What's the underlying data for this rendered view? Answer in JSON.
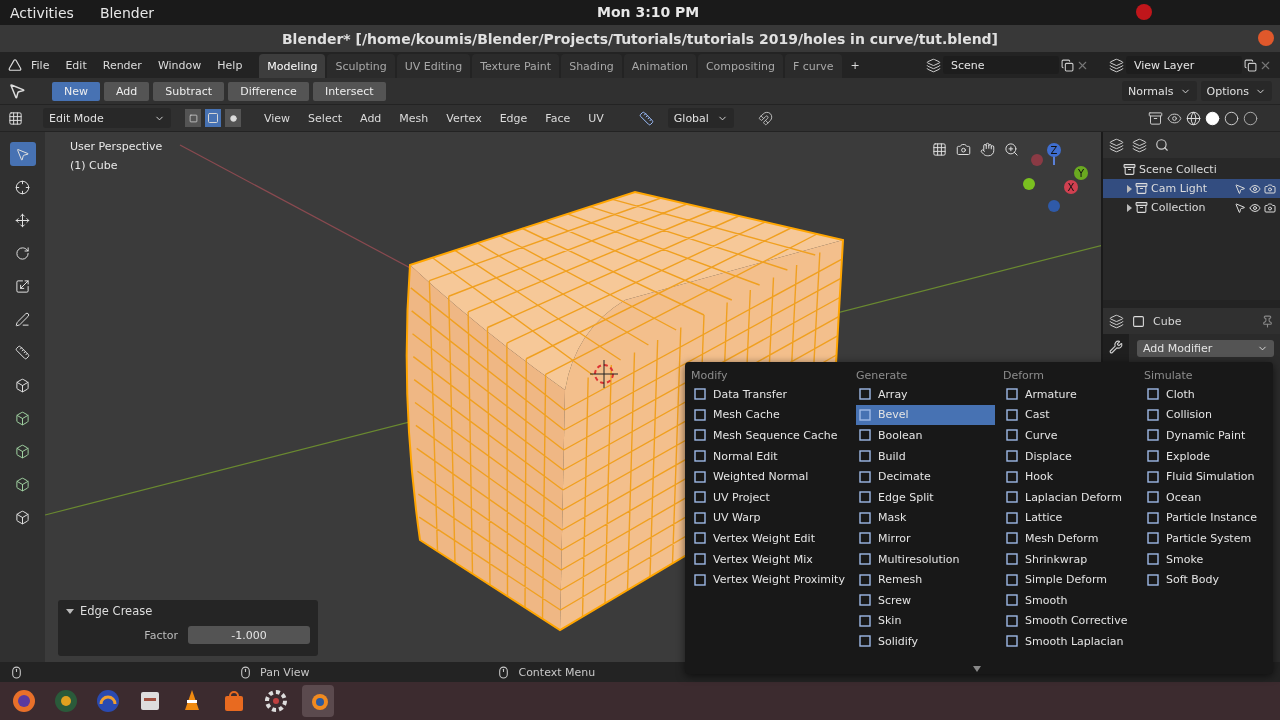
{
  "system_bar": {
    "activities": "Activities",
    "app": "Blender",
    "clock": "Mon  3:10 PM"
  },
  "window": {
    "title": "Blender* [/home/koumis/Blender/Projects/Tutorials/tutorials 2019/holes in curve/tut.blend]"
  },
  "menu_bar": [
    "File",
    "Edit",
    "Render",
    "Window",
    "Help"
  ],
  "workspaces": [
    {
      "label": "Modeling",
      "selected": true
    },
    {
      "label": "Sculpting",
      "selected": false
    },
    {
      "label": "UV Editing",
      "selected": false
    },
    {
      "label": "Texture Paint",
      "selected": false
    },
    {
      "label": "Shading",
      "selected": false
    },
    {
      "label": "Animation",
      "selected": false
    },
    {
      "label": "Compositing",
      "selected": false
    },
    {
      "label": "F curve",
      "selected": false
    }
  ],
  "add_workspace": "+",
  "scene": "Scene",
  "view_layer": "View Layer",
  "tool_header": {
    "modes": [
      {
        "label": "New",
        "selected": true
      },
      {
        "label": "Add",
        "selected": false
      },
      {
        "label": "Subtract",
        "selected": false
      },
      {
        "label": "Difference",
        "selected": false
      },
      {
        "label": "Intersect",
        "selected": false
      }
    ],
    "buttons": [
      "Normals",
      "Options"
    ]
  },
  "viewport_header": {
    "mode": "Edit Mode",
    "select_modes": [
      {
        "kind": "vertex",
        "selected": false
      },
      {
        "kind": "edge",
        "selected": true
      },
      {
        "kind": "face",
        "selected": false
      }
    ],
    "menus": [
      "View",
      "Select",
      "Add",
      "Mesh",
      "Vertex",
      "Edge",
      "Face",
      "UV"
    ],
    "orientation": "Global"
  },
  "viewport": {
    "perspective": "User Perspective",
    "object": "(1) Cube",
    "gizmo_axes": [
      "Z",
      "Y",
      "X"
    ]
  },
  "outliner": {
    "items": [
      {
        "label": "Scene Collecti",
        "children": [
          {
            "label": "Cam Light",
            "selected": true
          },
          {
            "label": "Collection",
            "selected": false
          }
        ]
      }
    ]
  },
  "properties": {
    "object": "Cube",
    "add_modifier": "Add Modifier"
  },
  "modifier_menu": {
    "columns": [
      {
        "heading": "Modify",
        "items": [
          {
            "label": "Data Transfer",
            "selected": false
          },
          {
            "label": "Mesh Cache",
            "selected": false
          },
          {
            "label": "Mesh Sequence Cache",
            "selected": false
          },
          {
            "label": "Normal Edit",
            "selected": false
          },
          {
            "label": "Weighted Normal",
            "selected": false
          },
          {
            "label": "UV Project",
            "selected": false
          },
          {
            "label": "UV Warp",
            "selected": false
          },
          {
            "label": "Vertex Weight Edit",
            "selected": false
          },
          {
            "label": "Vertex Weight Mix",
            "selected": false
          },
          {
            "label": "Vertex Weight Proximity",
            "selected": false
          }
        ]
      },
      {
        "heading": "Generate",
        "items": [
          {
            "label": "Array",
            "selected": false
          },
          {
            "label": "Bevel",
            "selected": true
          },
          {
            "label": "Boolean",
            "selected": false
          },
          {
            "label": "Build",
            "selected": false
          },
          {
            "label": "Decimate",
            "selected": false
          },
          {
            "label": "Edge Split",
            "selected": false
          },
          {
            "label": "Mask",
            "selected": false
          },
          {
            "label": "Mirror",
            "selected": false
          },
          {
            "label": "Multiresolution",
            "selected": false
          },
          {
            "label": "Remesh",
            "selected": false
          },
          {
            "label": "Screw",
            "selected": false
          },
          {
            "label": "Skin",
            "selected": false
          },
          {
            "label": "Solidify",
            "selected": false
          }
        ]
      },
      {
        "heading": "Deform",
        "items": [
          {
            "label": "Armature",
            "selected": false
          },
          {
            "label": "Cast",
            "selected": false
          },
          {
            "label": "Curve",
            "selected": false
          },
          {
            "label": "Displace",
            "selected": false
          },
          {
            "label": "Hook",
            "selected": false
          },
          {
            "label": "Laplacian Deform",
            "selected": false
          },
          {
            "label": "Lattice",
            "selected": false
          },
          {
            "label": "Mesh Deform",
            "selected": false
          },
          {
            "label": "Shrinkwrap",
            "selected": false
          },
          {
            "label": "Simple Deform",
            "selected": false
          },
          {
            "label": "Smooth",
            "selected": false
          },
          {
            "label": "Smooth Corrective",
            "selected": false
          },
          {
            "label": "Smooth Laplacian",
            "selected": false
          }
        ]
      },
      {
        "heading": "Simulate",
        "items": [
          {
            "label": "Cloth",
            "selected": false
          },
          {
            "label": "Collision",
            "selected": false
          },
          {
            "label": "Dynamic Paint",
            "selected": false
          },
          {
            "label": "Explode",
            "selected": false
          },
          {
            "label": "Fluid Simulation",
            "selected": false
          },
          {
            "label": "Ocean",
            "selected": false
          },
          {
            "label": "Particle Instance",
            "selected": false
          },
          {
            "label": "Particle System",
            "selected": false
          },
          {
            "label": "Smoke",
            "selected": false
          },
          {
            "label": "Soft Body",
            "selected": false
          }
        ]
      }
    ]
  },
  "last_operation": {
    "title": "Edge Crease",
    "field_label": "Factor",
    "field_value": "-1.000"
  },
  "status_bar": [
    "Pan View",
    "Context Menu"
  ]
}
